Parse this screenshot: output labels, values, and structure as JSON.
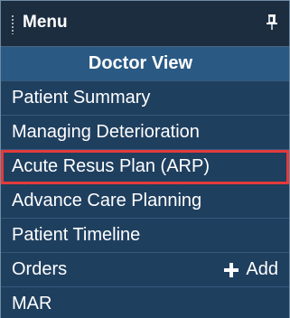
{
  "menu": {
    "title": "Menu",
    "pin_icon": "pin-icon",
    "items": [
      {
        "label": "Doctor View",
        "state": "selected"
      },
      {
        "label": "Patient Summary"
      },
      {
        "label": "Managing Deterioration"
      },
      {
        "label": "Acute Resus Plan (ARP)",
        "state": "highlighted"
      },
      {
        "label": "Advance Care Planning"
      },
      {
        "label": "Patient Timeline"
      },
      {
        "label": "Orders",
        "action": {
          "icon": "plus-icon",
          "label": "Add"
        }
      },
      {
        "label": "MAR"
      }
    ]
  },
  "colors": {
    "header_bg": "#1c2d3f",
    "item_bg": "#1f3f5f",
    "selected_bg": "#2a5a84",
    "highlight_border": "#e23a3a",
    "text": "#ffffff"
  }
}
